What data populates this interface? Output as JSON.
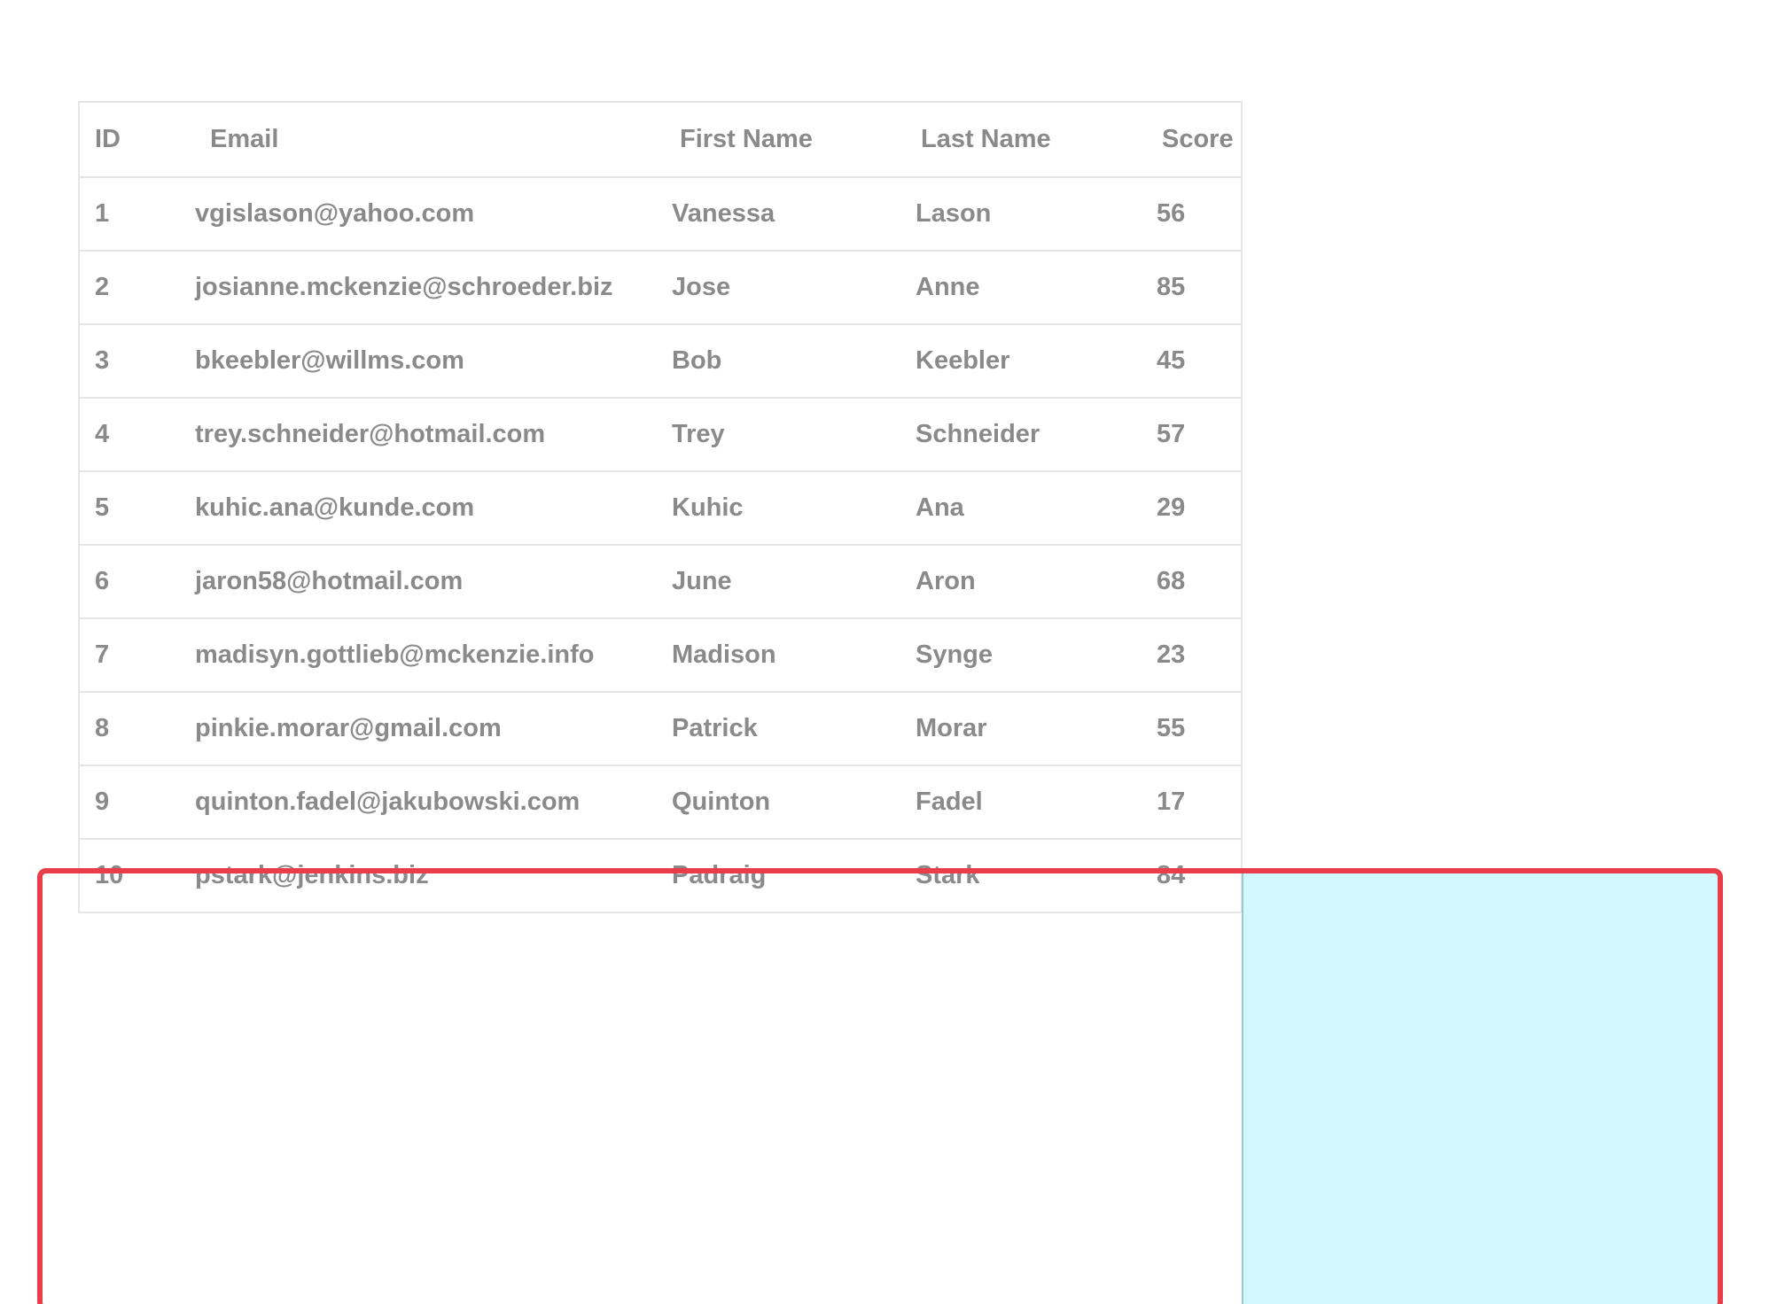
{
  "table": {
    "headers": {
      "id": "ID",
      "email": "Email",
      "first_name": "First Name",
      "last_name": "Last Name",
      "score": "Score"
    },
    "rows": [
      {
        "id": "1",
        "email": "vgislason@yahoo.com",
        "first_name": "Vanessa",
        "last_name": "Lason",
        "score": "56"
      },
      {
        "id": "2",
        "email": "josianne.mckenzie@schroeder.biz",
        "first_name": "Jose",
        "last_name": "Anne",
        "score": "85"
      },
      {
        "id": "3",
        "email": "bkeebler@willms.com",
        "first_name": "Bob",
        "last_name": "Keebler",
        "score": "45"
      },
      {
        "id": "4",
        "email": "trey.schneider@hotmail.com",
        "first_name": "Trey",
        "last_name": "Schneider",
        "score": "57"
      },
      {
        "id": "5",
        "email": "kuhic.ana@kunde.com",
        "first_name": "Kuhic",
        "last_name": "Ana",
        "score": "29"
      },
      {
        "id": "6",
        "email": "jaron58@hotmail.com",
        "first_name": "June",
        "last_name": "Aron",
        "score": "68"
      },
      {
        "id": "7",
        "email": "madisyn.gottlieb@mckenzie.info",
        "first_name": "Madison",
        "last_name": "Synge",
        "score": "23"
      },
      {
        "id": "8",
        "email": "pinkie.morar@gmail.com",
        "first_name": "Patrick",
        "last_name": "Morar",
        "score": "55"
      },
      {
        "id": "9",
        "email": "quinton.fadel@jakubowski.com",
        "first_name": "Quinton",
        "last_name": "Fadel",
        "score": "17"
      },
      {
        "id": "10",
        "email": "pstark@jenkins.biz",
        "first_name": "Padraig",
        "last_name": "Stark",
        "score": "84"
      }
    ]
  },
  "colors": {
    "text": "#8a8a8a",
    "grid_line": "#e6e6e6",
    "drop_overlay": "#d2f7fc",
    "selection_outline": "#ea3d4a"
  }
}
